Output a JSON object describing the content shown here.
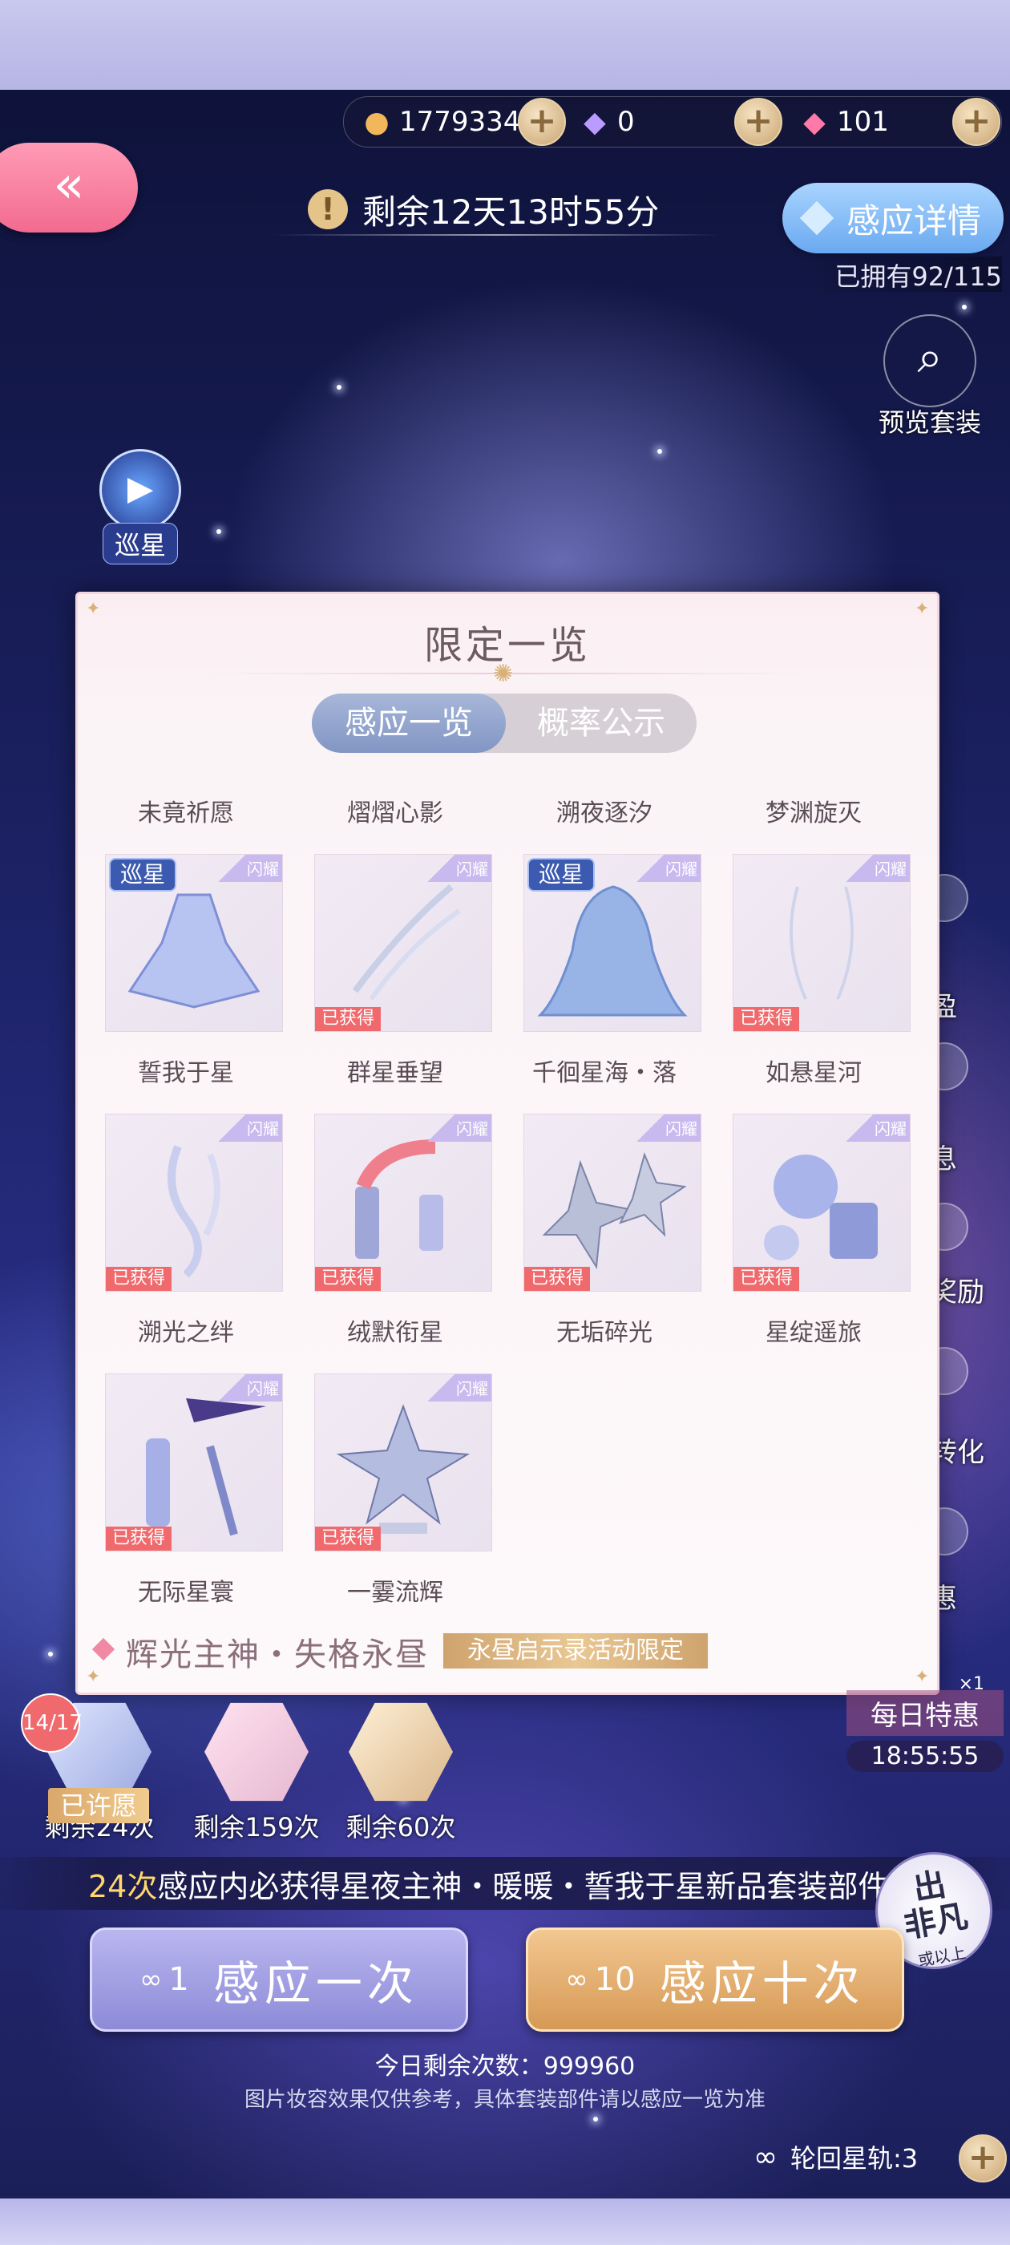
{
  "currency": [
    {
      "icon": "cat-coin-icon",
      "value": "1779334"
    },
    {
      "icon": "purple-diamond-icon",
      "value": "0"
    },
    {
      "icon": "pink-diamond-icon",
      "value": "101"
    }
  ],
  "timer": {
    "text": "剩余12天13时55分"
  },
  "header": {
    "detail_label": "感应详情",
    "owned": "已拥有92/115",
    "preview_label": "预览套装",
    "patrol_label": "巡星"
  },
  "side_menu": [
    "盈",
    "息",
    "奖励",
    "转化",
    "惠"
  ],
  "modal": {
    "title": "限定一览",
    "tabs": [
      {
        "label": "感应一览"
      },
      {
        "label": "概率公示"
      }
    ],
    "top_labels": [
      "未竟祈愿",
      "熠熠心影",
      "溯夜逐汐",
      "梦渊旋灭"
    ],
    "items": [
      {
        "label": "誓我于星",
        "xunxing": "巡星",
        "obtained": ""
      },
      {
        "label": "群星垂望",
        "xunxing": "",
        "obtained": "已获得"
      },
      {
        "label": "千徊星海・落",
        "xunxing": "巡星",
        "obtained": ""
      },
      {
        "label": "如悬星河",
        "xunxing": "",
        "obtained": "已获得"
      },
      {
        "label": "溯光之绊",
        "xunxing": "",
        "obtained": "已获得"
      },
      {
        "label": "绒默衔星",
        "xunxing": "",
        "obtained": "已获得"
      },
      {
        "label": "无垢碎光",
        "xunxing": "",
        "obtained": "已获得"
      },
      {
        "label": "星绽遥旅",
        "xunxing": "",
        "obtained": "已获得"
      },
      {
        "label": "无际星寰",
        "xunxing": "",
        "obtained": "已获得"
      },
      {
        "label": "一霎流辉",
        "xunxing": "",
        "obtained": "已获得"
      }
    ],
    "corner_flag": "闪耀",
    "footer_name": "辉光主神・失格永昼",
    "footer_badge": "永昼启示录活动限定"
  },
  "pools": [
    {
      "badge": "14/17",
      "status": "已许愿",
      "remain": "剩余24次"
    },
    {
      "remain": "剩余159次"
    },
    {
      "remain": "剩余60次"
    }
  ],
  "daily": {
    "label": "每日特惠",
    "time": "18:55:55",
    "count": "×1"
  },
  "banner": {
    "count": "24次",
    "text": "感应内必获得星夜主神・暖暖・誓我于星新品套装部件"
  },
  "extra_badge": {
    "line1": "出",
    "line2": "非凡",
    "line3": "或以上"
  },
  "buttons": {
    "one": {
      "num": "1",
      "label": "感应一次"
    },
    "ten": {
      "num": "10",
      "label": "感应十次"
    }
  },
  "remain_today": "今日剩余次数：999960",
  "note": "图片妆容效果仅供参考，具体套装部件请以感应一览为准",
  "trace": {
    "label": "轮回星轨:3"
  }
}
